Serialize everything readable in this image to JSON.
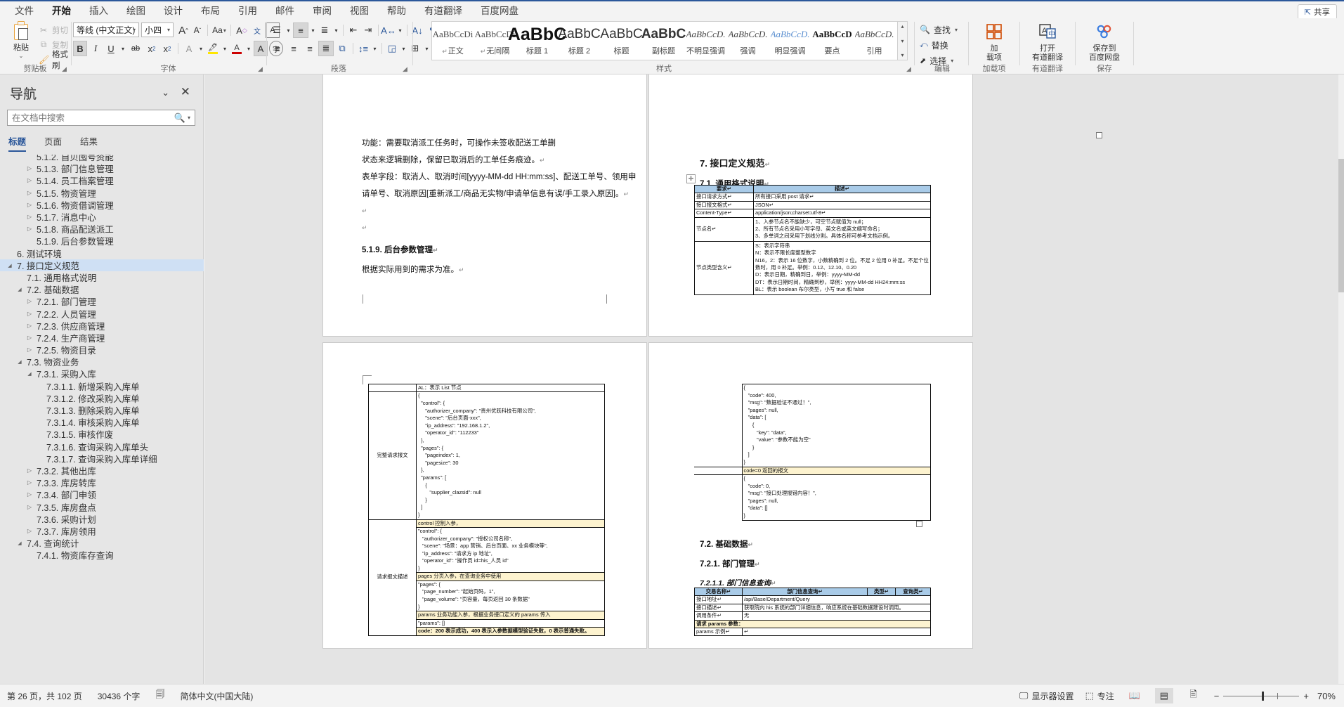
{
  "window": {
    "share_label": "共享",
    "share_icon": "share-icon"
  },
  "tabs": [
    {
      "label": "文件",
      "active": false
    },
    {
      "label": "开始",
      "active": true
    },
    {
      "label": "插入",
      "active": false
    },
    {
      "label": "绘图",
      "active": false
    },
    {
      "label": "设计",
      "active": false
    },
    {
      "label": "布局",
      "active": false
    },
    {
      "label": "引用",
      "active": false
    },
    {
      "label": "邮件",
      "active": false
    },
    {
      "label": "审阅",
      "active": false
    },
    {
      "label": "视图",
      "active": false
    },
    {
      "label": "帮助",
      "active": false
    },
    {
      "label": "有道翻译",
      "active": false
    },
    {
      "label": "百度网盘",
      "active": false
    }
  ],
  "ribbon": {
    "groups": {
      "clipboard": {
        "label": "剪贴板",
        "paste": "粘贴",
        "cut": "剪切",
        "copy": "复制",
        "format_painter": "格式刷"
      },
      "font": {
        "label": "字体",
        "font_name": "等线 (中文正文)",
        "font_size": "小四",
        "grow": "A^",
        "shrink": "Av",
        "change_case": "Aa",
        "clear_format": "清除所有格式",
        "phonetic": "拼音指南",
        "char_border": "字符边框",
        "bold": "B",
        "italic": "I",
        "underline": "U",
        "strike": "ab",
        "subscript": "x₂",
        "superscript": "x²",
        "text_effects": "文本效果",
        "highlight": "突出显示",
        "font_color": "字体颜色",
        "shading": "A",
        "enclose": "字"
      },
      "paragraph": {
        "label": "段落",
        "bullets": "项目符号",
        "numbering": "编号",
        "multilevel": "多级列表",
        "dec_indent": "减少缩进量",
        "inc_indent": "增加缩进量",
        "sort": "排序",
        "show_marks": "显示编辑标记",
        "align_left": "左对齐",
        "align_center": "居中",
        "align_right": "右对齐",
        "justify": "两端对齐",
        "distribute": "分散对齐",
        "line_spacing": "行和段落间距",
        "fill": "底纹",
        "borders": "边框"
      },
      "styles": {
        "label": "样式",
        "items": [
          {
            "sample": "AaBbCcDi",
            "name": "正文",
            "mark": "↵",
            "kind": "normal"
          },
          {
            "sample": "AaBbCcDi",
            "name": "无间隔",
            "mark": "↵",
            "kind": "normal"
          },
          {
            "sample": "AaBbC",
            "name": "标题 1",
            "mark": "",
            "kind": "h1"
          },
          {
            "sample": "AaBbC",
            "name": "标题 2",
            "mark": "",
            "kind": "h2"
          },
          {
            "sample": "AaBbC",
            "name": "标题",
            "mark": "",
            "kind": "title"
          },
          {
            "sample": "AaBbC",
            "name": "副标题",
            "mark": "",
            "kind": "subtitle"
          },
          {
            "sample": "AaBbCcD.",
            "name": "不明显强调",
            "mark": "",
            "kind": "italic"
          },
          {
            "sample": "AaBbCcD.",
            "name": "强调",
            "mark": "",
            "kind": "italic"
          },
          {
            "sample": "AaBbCcD.",
            "name": "明显强调",
            "mark": "",
            "kind": "italicblue"
          },
          {
            "sample": "AaBbCcD",
            "name": "要点",
            "mark": "",
            "kind": "boldserif"
          },
          {
            "sample": "AaBbCcD.",
            "name": "引用",
            "mark": "",
            "kind": "italic"
          }
        ]
      },
      "editing": {
        "label": "编辑",
        "find": "查找",
        "replace": "替换",
        "select": "选择"
      },
      "addins": {
        "label": "加载项",
        "button": "加\n载项",
        "line1": "加",
        "line2": "载项"
      },
      "youdao": {
        "label": "有道翻译",
        "line1": "打开",
        "line2": "有道翻译"
      },
      "baidu": {
        "label": "保存",
        "line1": "保存到",
        "line2": "百度网盘"
      }
    }
  },
  "navigation": {
    "title": "导航",
    "search_placeholder": "在文档中搜索",
    "search_value": "",
    "tabs": [
      {
        "label": "标题",
        "active": true
      },
      {
        "label": "页面",
        "active": false
      },
      {
        "label": "结果",
        "active": false
      }
    ],
    "items": [
      {
        "label": "5.1.2. 自贝囤号资能",
        "indent": 3,
        "twisty": "none",
        "selected": false,
        "clipped": true
      },
      {
        "label": "5.1.3. 部门信息管理",
        "indent": 3,
        "twisty": "closed",
        "selected": false
      },
      {
        "label": "5.1.4. 员工档案管理",
        "indent": 3,
        "twisty": "closed",
        "selected": false
      },
      {
        "label": "5.1.5. 物资管理",
        "indent": 3,
        "twisty": "closed",
        "selected": false
      },
      {
        "label": "5.1.6. 物资借调管理",
        "indent": 3,
        "twisty": "closed",
        "selected": false
      },
      {
        "label": "5.1.7. 消息中心",
        "indent": 3,
        "twisty": "closed",
        "selected": false
      },
      {
        "label": "5.1.8. 商品配送派工",
        "indent": 3,
        "twisty": "closed",
        "selected": false
      },
      {
        "label": "5.1.9. 后台参数管理",
        "indent": 3,
        "twisty": "none",
        "selected": false
      },
      {
        "label": "6. 测试环境",
        "indent": 1,
        "twisty": "none",
        "selected": false
      },
      {
        "label": "7. 接口定义规范",
        "indent": 1,
        "twisty": "open",
        "selected": true
      },
      {
        "label": "7.1. 通用格式说明",
        "indent": 2,
        "twisty": "none",
        "selected": false
      },
      {
        "label": "7.2. 基础数据",
        "indent": 2,
        "twisty": "open",
        "selected": false
      },
      {
        "label": "7.2.1. 部门管理",
        "indent": 3,
        "twisty": "closed",
        "selected": false
      },
      {
        "label": "7.2.2. 人员管理",
        "indent": 3,
        "twisty": "closed",
        "selected": false
      },
      {
        "label": "7.2.3. 供应商管理",
        "indent": 3,
        "twisty": "closed",
        "selected": false
      },
      {
        "label": "7.2.4. 生产商管理",
        "indent": 3,
        "twisty": "closed",
        "selected": false
      },
      {
        "label": "7.2.5. 物资目录",
        "indent": 3,
        "twisty": "closed",
        "selected": false
      },
      {
        "label": "7.3. 物资业务",
        "indent": 2,
        "twisty": "open",
        "selected": false
      },
      {
        "label": "7.3.1. 采购入库",
        "indent": 3,
        "twisty": "open",
        "selected": false
      },
      {
        "label": "7.3.1.1. 新增采购入库单",
        "indent": 4,
        "twisty": "none",
        "selected": false
      },
      {
        "label": "7.3.1.2. 修改采购入库单",
        "indent": 4,
        "twisty": "none",
        "selected": false
      },
      {
        "label": "7.3.1.3. 删除采购入库单",
        "indent": 4,
        "twisty": "none",
        "selected": false
      },
      {
        "label": "7.3.1.4. 审核采购入库单",
        "indent": 4,
        "twisty": "none",
        "selected": false
      },
      {
        "label": "7.3.1.5. 审核作废",
        "indent": 4,
        "twisty": "none",
        "selected": false
      },
      {
        "label": "7.3.1.6. 查询采购入库单头",
        "indent": 4,
        "twisty": "none",
        "selected": false
      },
      {
        "label": "7.3.1.7. 查询采购入库单详细",
        "indent": 4,
        "twisty": "none",
        "selected": false
      },
      {
        "label": "7.3.2. 其他出库",
        "indent": 3,
        "twisty": "closed",
        "selected": false
      },
      {
        "label": "7.3.3. 库房转库",
        "indent": 3,
        "twisty": "closed",
        "selected": false
      },
      {
        "label": "7.3.4. 部门申领",
        "indent": 3,
        "twisty": "closed",
        "selected": false
      },
      {
        "label": "7.3.5. 库房盘点",
        "indent": 3,
        "twisty": "closed",
        "selected": false
      },
      {
        "label": "7.3.6. 采购计划",
        "indent": 3,
        "twisty": "none",
        "selected": false
      },
      {
        "label": "7.3.7. 库房领用",
        "indent": 3,
        "twisty": "closed",
        "selected": false
      },
      {
        "label": "7.4. 查询统计",
        "indent": 2,
        "twisty": "open",
        "selected": false
      },
      {
        "label": "7.4.1. 物资库存查询",
        "indent": 3,
        "twisty": "none",
        "selected": false
      }
    ]
  },
  "document": {
    "page_top_left": {
      "paragraphs": [
        "功能：需要取消派工任务时，可操作未签收配送工单删",
        "状态来逻辑删除，保留已取消后的工单任务痕迹。",
        "表单字段：取消人、取消时间[yyyy-MM-dd HH:mm:ss]、配送工单号、领用申",
        "请单号、取消原因[重新派工/商品无实物/申请单信息有误/手工录入原因]。"
      ],
      "heading": "5.1.9. 后台参数管理",
      "after_heading": "根据实际用到的需求为准。"
    },
    "page_top_right": {
      "h1": "7.  接口定义规范",
      "h2": "7.1.  通用格式说明",
      "table": {
        "headers": [
          "要求",
          "描述"
        ],
        "rows": [
          [
            "接口请求方式",
            "所有接口采用 post 请求"
          ],
          [
            "接口报文格式",
            "JSON"
          ],
          [
            "Content-Type",
            "application/json;charset:utf-8"
          ],
          [
            "节点名",
            "1、入参节点名不能缺少，可空节点赋值为 null；\n2、所有节点名采用小写字母、英文名或英文缩写命名；\n3、多单词之间采用下划线分割。具体名称可参考文档示例。"
          ],
          [
            "节点类型含义",
            "S：表示字符串\nN：表示不限长度整型数字\nN16，2：表示 16 位数字，小数精确到 2 位。不足 2 位用 0 补足。不足个位数时，用 0 补足。举例：0.12、12.10、0.20\nD：表示日期，精确到日，举例：yyyy-MM-dd\nDT：表示日期时间，精确到秒，举例：yyyy-MM-dd HH24:mm:ss\nBL：表示 boolean 布尔类型，小写 true 和 false"
          ]
        ]
      }
    },
    "page_bottom_left": {
      "rows": [
        {
          "label": "",
          "note": "AL：表示 List 节点"
        },
        {
          "label": "完整请求报文",
          "json": "{\n  \"control\": {\n     \"authorizer_company\": \"贵州优跃科技有限公司\",\n     \"scene\": \"后台页面-xxx\",\n     \"ip_address\": \"192.168.1.2\",\n     \"operator_id\": \"112233\"\n  },\n  \"pages\": {\n     \"pageindex\": 1,\n     \"pagesize\": 30\n  },\n  \"params\": [\n     {\n        \"supplier_clazsid\": null\n     }\n  ]\n}"
        },
        {
          "label": "请求报文描述",
          "band1": "control 控制入参，",
          "json2": "\"control\": {\n   \"authorizer_company\": \"授权公司名称\",\n   \"scene\": \"场景：app 营销、后台页面、xx 业务模块等\",\n   \"ip_address\": \"请求方 ip 地址\",\n   \"operator_id\": \"操作员 id=his_人员 id\"\n}",
          "band2": "pages 分页入参，在查询业务中使用",
          "json3": "\"pages\": {\n   \"page_number\": \"起始页码，1\",\n   \"page_volume\": \"页容量，每页返回 30 条数据\"\n}",
          "band3": "params 业务功能入参，根据业务接口定义的 params 传入",
          "json4": "\"params\": []",
          "band4": "code：200 表示成功，400 表示入参数据模型验证失败，0 表示普通失败。"
        }
      ]
    },
    "page_bottom_right": {
      "json_top": "{\n   \"code\": 400,\n   \"msg\": \"数据验证不通过！\",\n   \"pages\": null,\n   \"data\": [\n      {\n         \"key\": \"data\",\n         \"value\": \"参数不能为空\"\n      }\n   ]\n}",
      "band": "code=0 返回的报文",
      "json_bottom": "{\n   \"code\": 0,\n   \"msg\": \"接口处理报错内容！\",\n   \"pages\": null,\n   \"data\": []\n}",
      "h2": "7.2.  基础数据",
      "h3": "7.2.1.  部门管理",
      "h4": "7.2.1.1.  部门信息查询",
      "table": {
        "headers": [
          "交易名称",
          "部门信息查询",
          "类型",
          "查询类"
        ],
        "rows": [
          [
            "接口地址",
            "/api/Base/Department/Query",
            "",
            ""
          ],
          [
            "接口描述",
            "获取院内 his 系统的部门详细信息，响应系统在基础数据建设时调用。",
            "",
            ""
          ],
          [
            "调用条件",
            "无",
            "",
            ""
          ]
        ],
        "band": "请求 params 参数：",
        "last_row": [
          "params 示例",
          ""
        ]
      }
    }
  },
  "statusbar": {
    "page_info": "第 26 页，共 102 页",
    "word_count": "30436 个字",
    "proof_icon": "proofing-icon",
    "language": "简体中文(中国大陆)",
    "display_settings": "显示器设置",
    "focus": "专注",
    "view_read": "read-view-icon",
    "view_print": "print-view-icon",
    "view_web": "web-view-icon",
    "zoom_out": "−",
    "zoom_in": "+",
    "zoom_level": "70%"
  },
  "colors": {
    "accent": "#2b579a",
    "nav_selected": "#cfe0f4",
    "table_header": "#a9cbe8",
    "highlight_band": "#fdf3cf",
    "ribbon_bg": "#f3f3f3"
  }
}
